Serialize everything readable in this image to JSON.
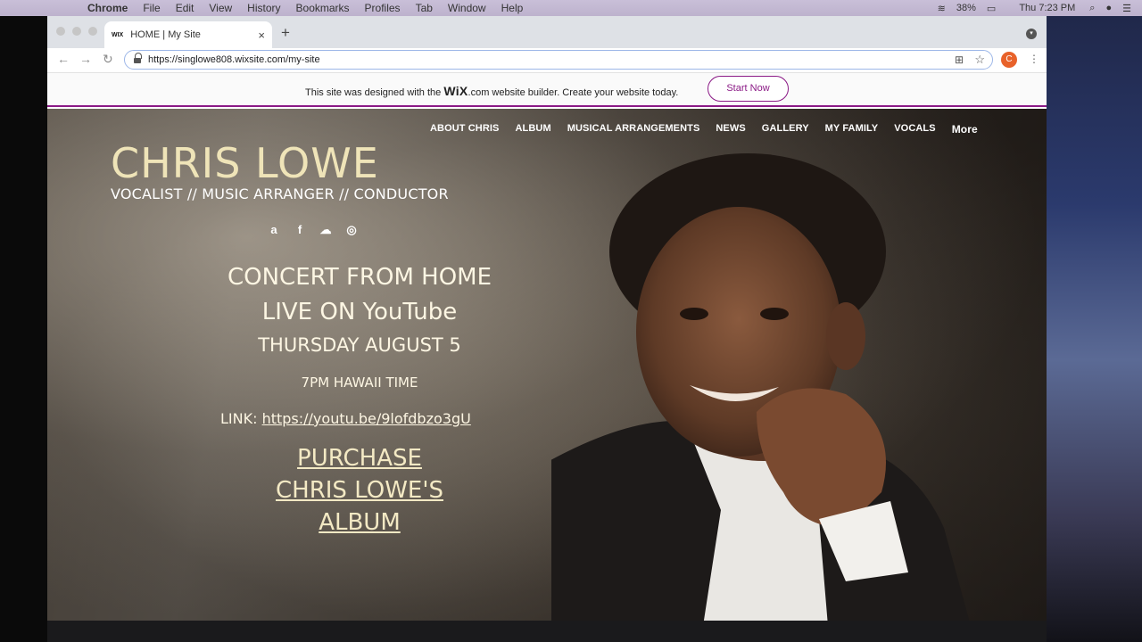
{
  "menubar": {
    "app": "Chrome",
    "items": [
      "File",
      "Edit",
      "View",
      "History",
      "Bookmarks",
      "Profiles",
      "Tab",
      "Window",
      "Help"
    ],
    "battery": "38%",
    "clock": "Thu 7:23 PM"
  },
  "browser": {
    "tab_favicon": "WIX",
    "tab_title": "HOME | My Site",
    "url": "https://singlowe808.wixsite.com/my-site",
    "profile_initial": "C"
  },
  "wix_banner": {
    "text_before": "This site was designed with the ",
    "brand": "WiX",
    "text_after": ".com website builder. Create your website today.",
    "button": "Start Now"
  },
  "site": {
    "nav": [
      "ABOUT CHRIS",
      "ALBUM",
      "MUSICAL ARRANGEMENTS",
      "NEWS",
      "GALLERY",
      "MY FAMILY",
      "VOCALS"
    ],
    "nav_more": "More",
    "name": "CHRIS LOWE",
    "tagline": "VOCALIST // MUSIC ARRANGER // CONDUCTOR",
    "social_icons": [
      "apple-icon",
      "amazon-icon",
      "facebook-icon",
      "soundcloud-icon",
      "instagram-icon"
    ],
    "concert_line1": "CONCERT FROM HOME",
    "concert_line2": "LIVE ON YouTube",
    "date": "THURSDAY AUGUST 5",
    "time": "7PM HAWAII TIME",
    "link_label": "LINK: ",
    "link_url": "https://youtu.be/9lofdbzo3gU",
    "purchase_line1": "PURCHASE",
    "purchase_line2": "CHRIS LOWE'S",
    "purchase_line3": "ALBUM"
  },
  "colors": {
    "wix_accent": "#8b1a86",
    "title_gold": "#efe4b8"
  }
}
